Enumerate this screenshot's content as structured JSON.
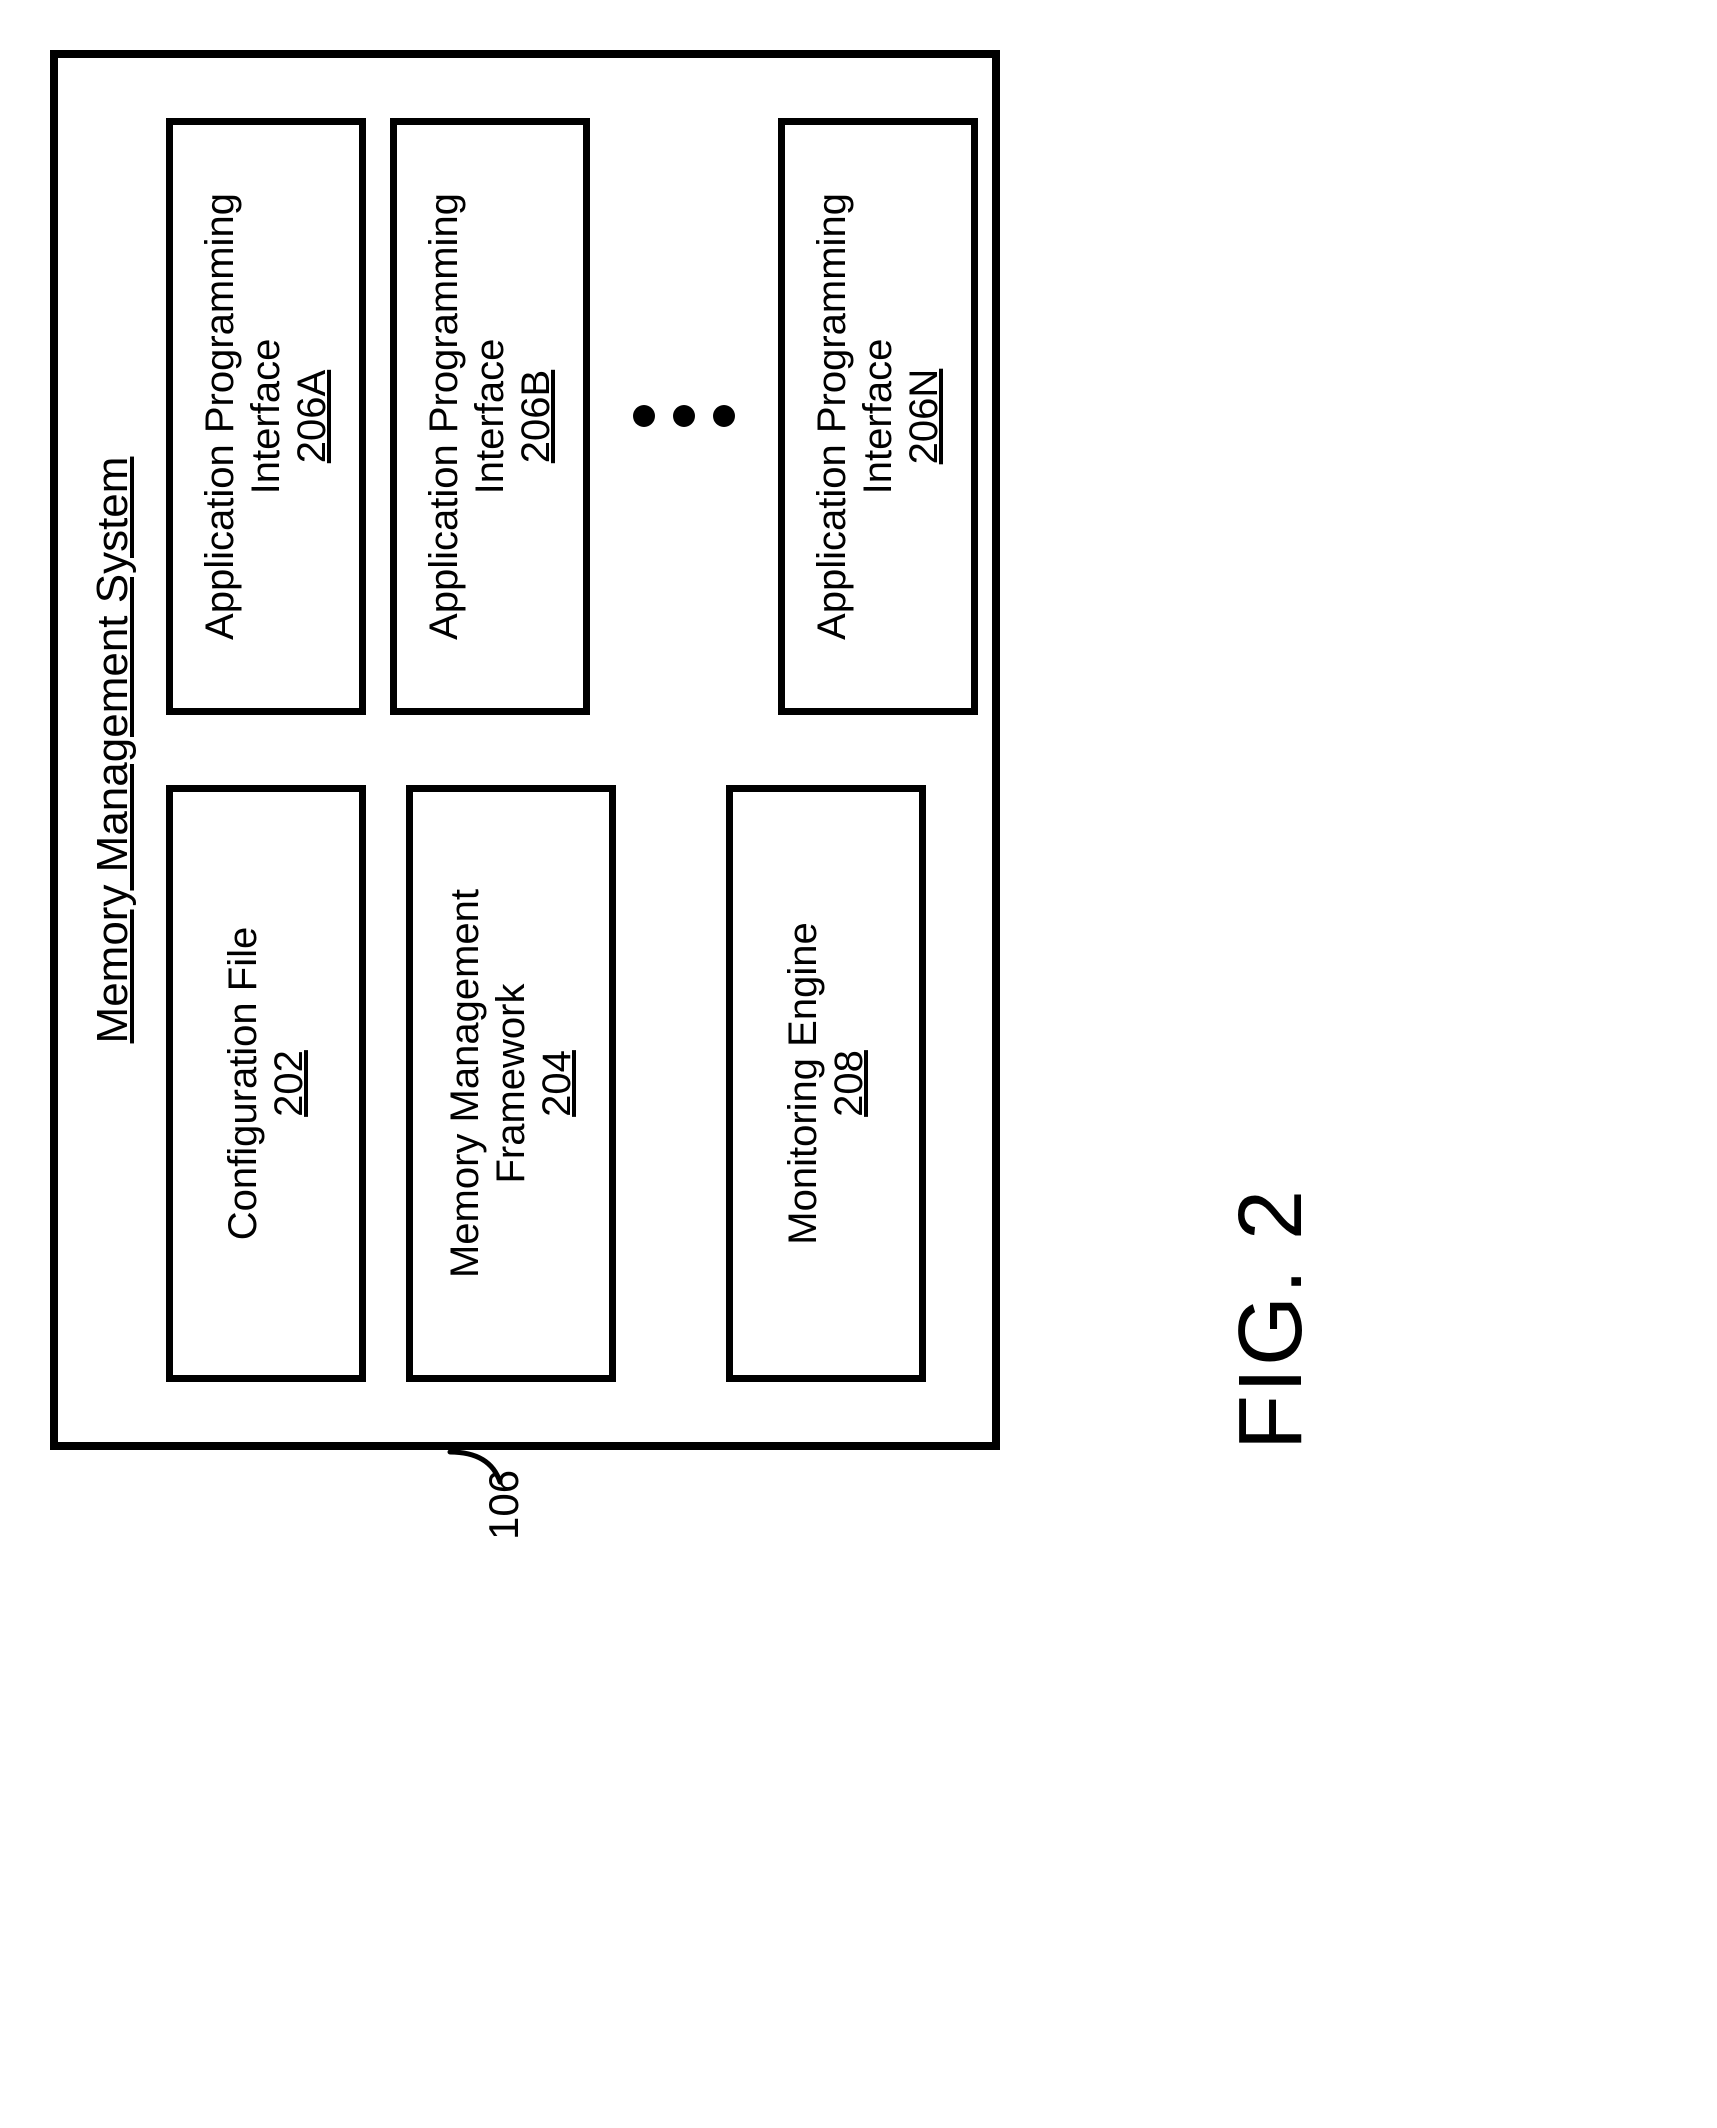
{
  "figure_caption": "FIG. 2",
  "outer_ref": "106",
  "system_title": "Memory Management System",
  "left": {
    "config": {
      "line1": "Configuration File",
      "line2": "",
      "ref": "202"
    },
    "framework": {
      "line1": "Memory Management",
      "line2": "Framework",
      "ref": "204"
    },
    "monitor": {
      "line1": "Monitoring Engine",
      "line2": "",
      "ref": "208"
    }
  },
  "right": {
    "api_a": {
      "line1": "Application Programming",
      "line2": "Interface",
      "ref": "206A"
    },
    "api_b": {
      "line1": "Application Programming",
      "line2": "Interface",
      "ref": "206B"
    },
    "api_n": {
      "line1": "Application Programming",
      "line2": "Interface",
      "ref": "206N"
    }
  }
}
